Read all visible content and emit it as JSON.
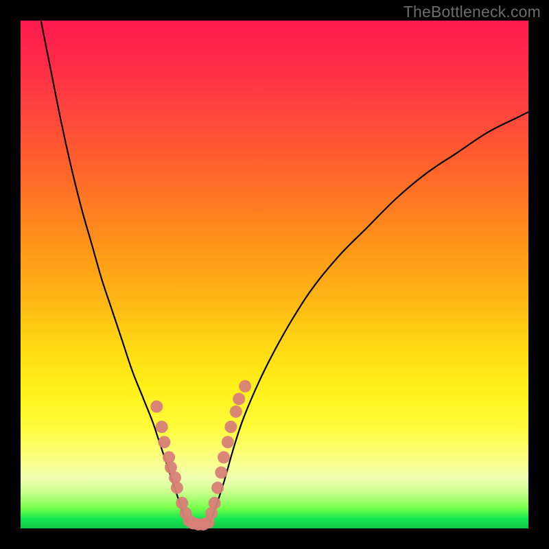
{
  "watermark": "TheBottleneck.com",
  "colors": {
    "frame": "#000000",
    "curve": "#000000",
    "dot": "#d88078",
    "gradient_top": "#ff1a4d",
    "gradient_bottom": "#10c848"
  },
  "chart_data": {
    "type": "line",
    "title": "",
    "xlabel": "",
    "ylabel": "",
    "xlim": [
      0,
      100
    ],
    "ylim": [
      0,
      100
    ],
    "series": [
      {
        "name": "left-curve",
        "x": [
          4,
          6,
          8,
          10,
          12,
          14,
          16,
          18,
          20,
          22,
          24,
          26,
          27,
          28,
          29,
          30,
          31,
          32,
          33
        ],
        "y": [
          100,
          90,
          80,
          71,
          63,
          56,
          49,
          43,
          37,
          31,
          26,
          21,
          18,
          15,
          12,
          9,
          6,
          3,
          1
        ]
      },
      {
        "name": "bottom-flat",
        "x": [
          33,
          34,
          35,
          36,
          37
        ],
        "y": [
          1,
          0.5,
          0.5,
          0.6,
          0.8
        ]
      },
      {
        "name": "right-curve",
        "x": [
          37,
          38,
          40,
          42,
          44,
          47,
          50,
          54,
          58,
          63,
          68,
          74,
          80,
          86,
          92,
          98,
          100
        ],
        "y": [
          0.8,
          3,
          9,
          16,
          22,
          29,
          35,
          42,
          48,
          54,
          59,
          65,
          70,
          74,
          78,
          81,
          82
        ]
      }
    ],
    "dots": {
      "name": "highlighted-points",
      "points": [
        {
          "x": 26.8,
          "y": 24
        },
        {
          "x": 27.8,
          "y": 20
        },
        {
          "x": 28.3,
          "y": 17
        },
        {
          "x": 29.2,
          "y": 14
        },
        {
          "x": 29.6,
          "y": 12
        },
        {
          "x": 30.4,
          "y": 10
        },
        {
          "x": 30.8,
          "y": 8
        },
        {
          "x": 31.8,
          "y": 5
        },
        {
          "x": 32.5,
          "y": 3
        },
        {
          "x": 33.2,
          "y": 1.5
        },
        {
          "x": 34.0,
          "y": 1
        },
        {
          "x": 35.0,
          "y": 0.8
        },
        {
          "x": 36.0,
          "y": 0.8
        },
        {
          "x": 37.0,
          "y": 1.2
        },
        {
          "x": 37.6,
          "y": 3
        },
        {
          "x": 38.2,
          "y": 5
        },
        {
          "x": 38.8,
          "y": 8
        },
        {
          "x": 39.5,
          "y": 11
        },
        {
          "x": 40.0,
          "y": 14
        },
        {
          "x": 40.8,
          "y": 17
        },
        {
          "x": 41.4,
          "y": 20
        },
        {
          "x": 42.4,
          "y": 23
        },
        {
          "x": 43.0,
          "y": 25.5
        },
        {
          "x": 44.2,
          "y": 28
        }
      ]
    }
  }
}
